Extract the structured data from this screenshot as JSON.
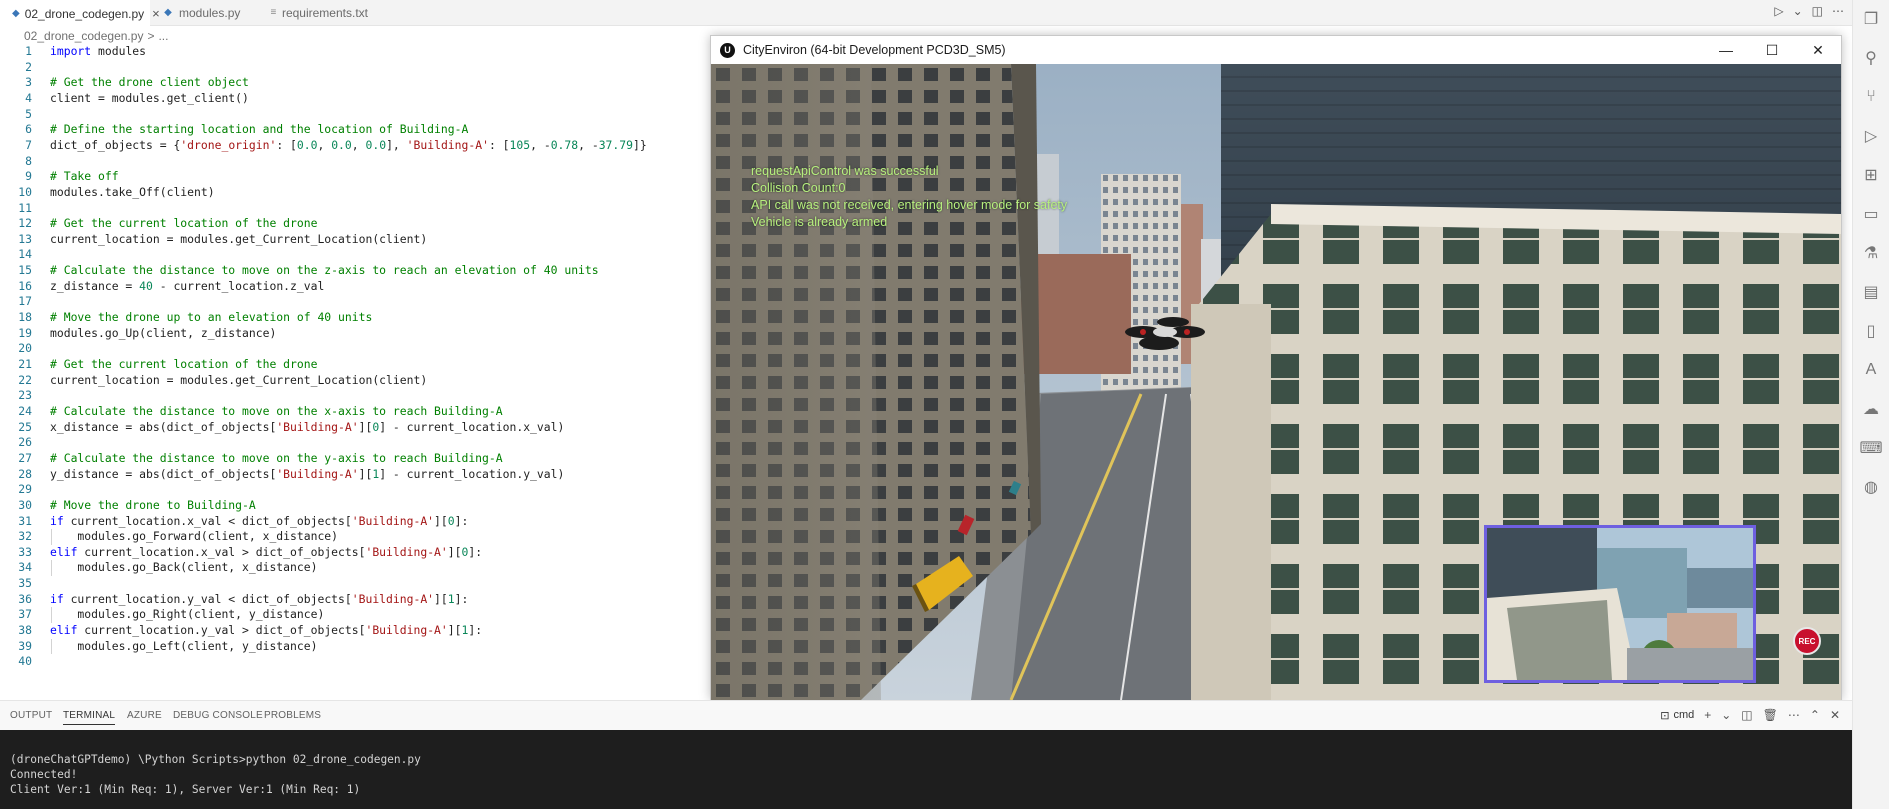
{
  "tabs": [
    {
      "label": "02_drone_codegen.py",
      "icon": "python-file-icon",
      "active": true
    },
    {
      "label": "modules.py",
      "icon": "python-file-icon",
      "active": false
    },
    {
      "label": "requirements.txt",
      "icon": "text-file-icon",
      "active": false
    }
  ],
  "breadcrumb": {
    "file": "02_drone_codegen.py",
    "sep": ">",
    "rest": "..."
  },
  "code_lines": [
    "import modules",
    "",
    "# Get the drone client object",
    "client = modules.get_client()",
    "",
    "# Define the starting location and the location of Building-A",
    "dict_of_objects = {'drone_origin': [0.0, 0.0, 0.0], 'Building-A': [105, -0.78, -37.79]}",
    "",
    "# Take off",
    "modules.take_Off(client)",
    "",
    "# Get the current location of the drone",
    "current_location = modules.get_Current_Location(client)",
    "",
    "# Calculate the distance to move on the z-axis to reach an elevation of 40 units",
    "z_distance = 40 - current_location.z_val",
    "",
    "# Move the drone up to an elevation of 40 units",
    "modules.go_Up(client, z_distance)",
    "",
    "# Get the current location of the drone",
    "current_location = modules.get_Current_Location(client)",
    "",
    "# Calculate the distance to move on the x-axis to reach Building-A",
    "x_distance = abs(dict_of_objects['Building-A'][0] - current_location.x_val)",
    "",
    "# Calculate the distance to move on the y-axis to reach Building-A",
    "y_distance = abs(dict_of_objects['Building-A'][1] - current_location.y_val)",
    "",
    "# Move the drone to Building-A",
    "if current_location.x_val < dict_of_objects['Building-A'][0]:",
    "    modules.go_Forward(client, x_distance)",
    "elif current_location.x_val > dict_of_objects['Building-A'][0]:",
    "    modules.go_Back(client, x_distance)",
    "",
    "if current_location.y_val < dict_of_objects['Building-A'][1]:",
    "    modules.go_Right(client, y_distance)",
    "elif current_location.y_val > dict_of_objects['Building-A'][1]:",
    "    modules.go_Left(client, y_distance)",
    ""
  ],
  "sim_window": {
    "title": "CityEnviron (64-bit Development PCD3D_SM5)",
    "logo": "U",
    "overlay": [
      "requestApiControl was successful",
      "Collision Count:0",
      "API call was not received, entering hover mode for safety",
      "Vehicle is already armed"
    ],
    "rec_label": "REC",
    "overlay_color": "#b6f07e",
    "pip_border_color": "#6e5fe0"
  },
  "panel_tabs": [
    "OUTPUT",
    "TERMINAL",
    "AZURE",
    "DEBUG CONSOLE",
    "PROBLEMS"
  ],
  "active_panel_tab": "TERMINAL",
  "terminal": {
    "shell": "cmd",
    "lines": [
      "(droneChatGPTdemo) \\Python Scripts>python 02_drone_codegen.py",
      "Connected!",
      "Client Ver:1 (Min Req: 1), Server Ver:1 (Min Req: 1)"
    ]
  },
  "activity_icons": [
    "explorer-icon",
    "search-icon",
    "source-control-icon",
    "run-debug-icon",
    "extensions-icon",
    "remote-explorer-icon",
    "testing-icon",
    "docker-icon",
    "notebook-icon",
    "azure-icon",
    "ai-icon",
    "terminal-icon",
    "accounts-icon"
  ],
  "colors": {
    "comment": "#008000",
    "keyword": "#0000ff",
    "string": "#a31515",
    "number": "#098658",
    "line_number": "#237893",
    "terminal_bg": "#1e1e1e"
  }
}
